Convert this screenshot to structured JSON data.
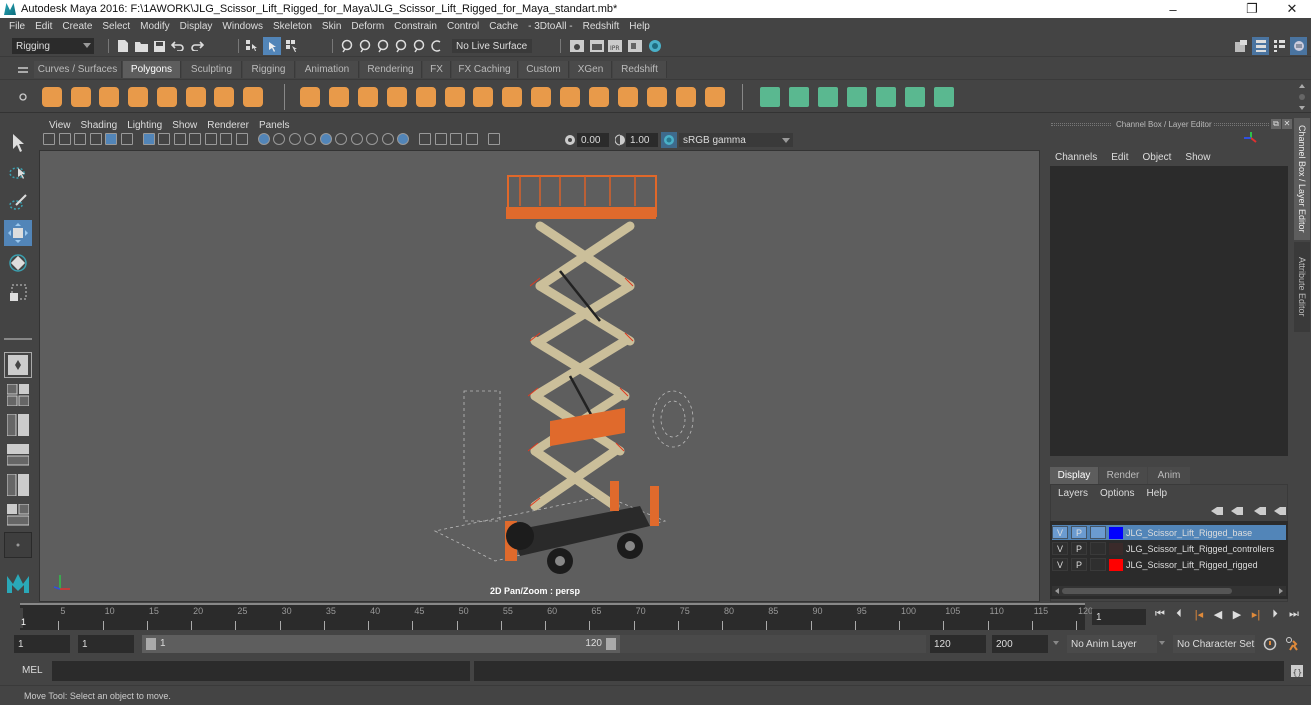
{
  "window": {
    "title": "Autodesk Maya 2016: F:\\1AWORK\\JLG_Scissor_Lift_Rigged_for_Maya\\JLG_Scissor_Lift_Rigged_for_Maya_standart.mb*",
    "minimize": "–",
    "restore": "❐",
    "close": "✕"
  },
  "menubar": [
    "File",
    "Edit",
    "Create",
    "Select",
    "Modify",
    "Display",
    "Windows",
    "Skeleton",
    "Skin",
    "Deform",
    "Constrain",
    "Control",
    "Cache",
    "- 3DtoAll -",
    "Redshift",
    "Help"
  ],
  "statusline": {
    "mode": "Rigging",
    "live_surface": "No Live Surface"
  },
  "shelf": {
    "tabs": [
      "Curves / Surfaces",
      "Polygons",
      "Sculpting",
      "Rigging",
      "Animation",
      "Rendering",
      "FX",
      "FX Caching",
      "Custom",
      "XGen",
      "Redshift"
    ],
    "active_tab": "Polygons",
    "primitive_icons": [
      "poly-sphere-icon",
      "poly-cube-icon",
      "poly-cylinder-icon",
      "poly-cone-icon",
      "poly-plane-icon",
      "poly-torus-icon",
      "poly-pyramid-icon",
      "poly-pipe-icon"
    ],
    "mesh_icons": [
      "combine-icon",
      "separate-icon",
      "mirror-icon",
      "smooth-icon",
      "extract-icon",
      "booleans-icon",
      "bevel-icon",
      "bridge-icon",
      "extrude-icon",
      "append-icon",
      "fill-hole-icon",
      "merge-icon",
      "multi-cut-icon",
      "target-weld-icon",
      "quad-draw-icon"
    ],
    "uv_icons": [
      "planar-uv-icon",
      "cylindrical-uv-icon",
      "spherical-uv-icon",
      "automatic-uv-icon",
      "unfold-uv-icon",
      "uv-editor-icon",
      "uv-sew-icon"
    ]
  },
  "viewport": {
    "menu": [
      "View",
      "Shading",
      "Lighting",
      "Show",
      "Renderer",
      "Panels"
    ],
    "exposure": "0.00",
    "gamma": "1.00",
    "color_space": "sRGB gamma",
    "hud_label": "2D Pan/Zoom : persp",
    "axis": {
      "x": "x",
      "y": "y",
      "z": "z"
    }
  },
  "channel_box": {
    "title": "Channel Box / Layer Editor",
    "menu": [
      "Channels",
      "Edit",
      "Object",
      "Show"
    ]
  },
  "side_tabs": [
    "Channel Box / Layer Editor",
    "Attribute Editor"
  ],
  "layer_editor": {
    "tabs": [
      "Display",
      "Render",
      "Anim"
    ],
    "active_tab": "Display",
    "menu": [
      "Layers",
      "Options",
      "Help"
    ],
    "layers": [
      {
        "v": "V",
        "p": "P",
        "name": "JLG_Scissor_Lift_Rigged_base",
        "color": "#0000ff",
        "selected": true
      },
      {
        "v": "V",
        "p": "P",
        "name": "JLG_Scissor_Lift_Rigged_controllers",
        "color": "#3a2a2a",
        "selected": false
      },
      {
        "v": "V",
        "p": "P",
        "name": "JLG_Scissor_Lift_Rigged_rigged",
        "color": "#ff0000",
        "selected": false
      }
    ]
  },
  "timeline": {
    "ticks": [
      "5",
      "10",
      "15",
      "20",
      "25",
      "30",
      "35",
      "40",
      "45",
      "50",
      "55",
      "60",
      "65",
      "70",
      "75",
      "80",
      "85",
      "90",
      "95",
      "100",
      "105",
      "110",
      "115",
      "120"
    ],
    "current_frame_marker": "1",
    "current_frame": "1"
  },
  "range": {
    "start": "1",
    "playback_start": "1",
    "slider_start": "1",
    "slider_end": "120",
    "playback_end": "120",
    "end": "200",
    "anim_layer": "No Anim Layer",
    "character_set": "No Character Set"
  },
  "cmdline": {
    "label": "MEL"
  },
  "helpline": {
    "text": "Move Tool: Select an object to move."
  }
}
